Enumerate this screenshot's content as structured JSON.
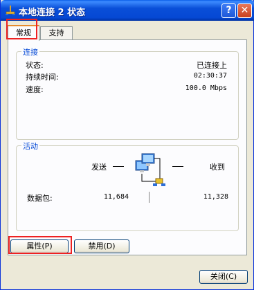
{
  "window": {
    "title": "本地连接 2 状态",
    "title_icon": "network-connection-icon",
    "help_button": "?",
    "close_button": "✕"
  },
  "tabs": [
    {
      "label": "常规",
      "selected": true
    },
    {
      "label": "支持",
      "selected": false
    }
  ],
  "connection": {
    "title": "连接",
    "status_label": "状态:",
    "status_value": "已连接上",
    "duration_label": "持续时间:",
    "duration_value": "02:30:37",
    "speed_label": "速度:",
    "speed_value": "100.0 Mbps"
  },
  "activity": {
    "title": "活动",
    "sent_label": "发送",
    "received_label": "收到",
    "packets_label": "数据包:",
    "packets_sent": "11,684",
    "packets_received": "11,328",
    "icon": "network-computers-icon"
  },
  "buttons": {
    "properties": "属性(P)",
    "disable": "禁用(D)",
    "close": "关闭(C)"
  },
  "colors": {
    "titlebar": "#0548d4",
    "group_title": "#0046d5",
    "highlight": "#ee2222",
    "tab_accent": "#e68b2c"
  }
}
